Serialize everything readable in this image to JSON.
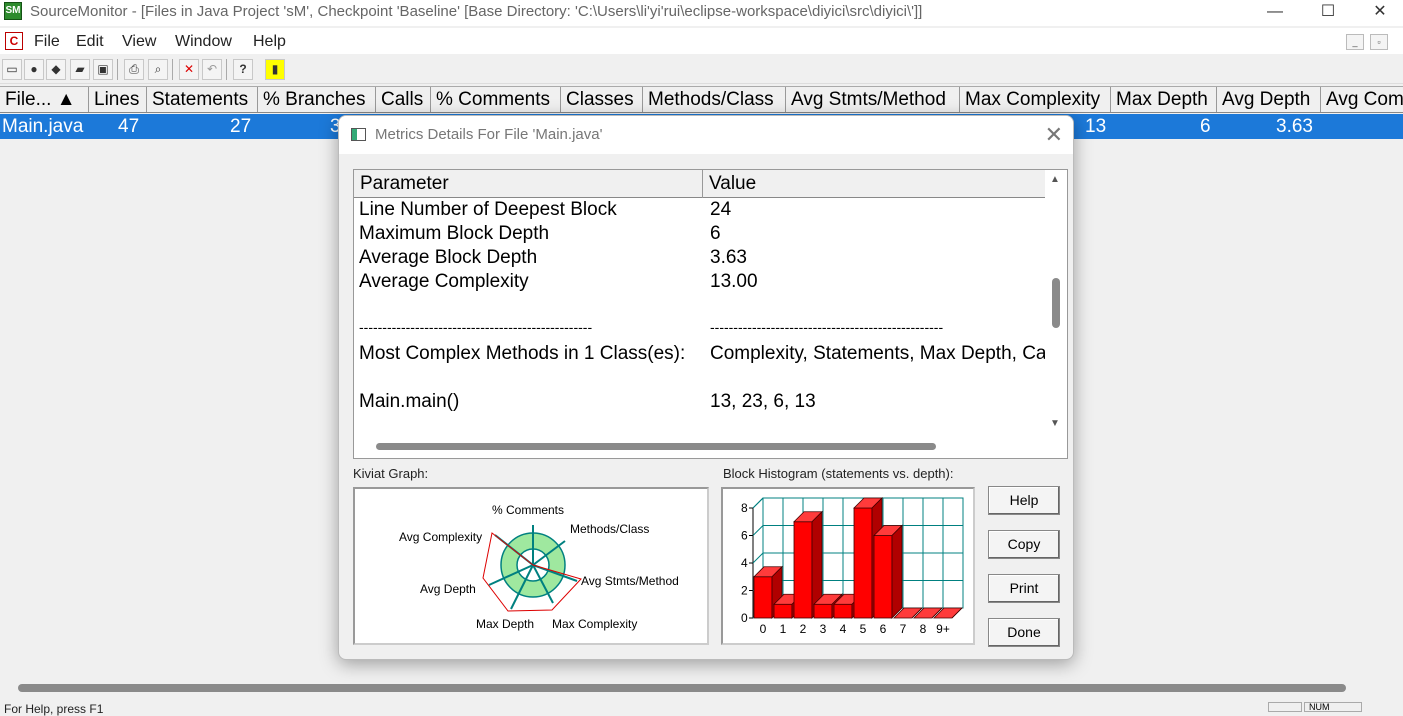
{
  "window": {
    "title": "SourceMonitor - [Files in Java Project 'sM', Checkpoint 'Baseline'  [Base Directory: 'C:\\Users\\li'yi'rui\\eclipse-workspace\\diyici\\src\\diyici\\']]",
    "minimize": "—",
    "maximize": "☐",
    "close": "✕"
  },
  "menu": {
    "items": [
      "File",
      "Edit",
      "View",
      "Window",
      "Help"
    ]
  },
  "table": {
    "headers": [
      "File... ▲",
      "Lines",
      "Statements",
      "% Branches",
      "Calls",
      "% Comments",
      "Classes",
      "Methods/Class",
      "Avg Stmts/Method",
      "Max Complexity",
      "Max Depth",
      "Avg Depth",
      "Avg Complexity"
    ],
    "row": {
      "file": "Main.java",
      "lines": "47",
      "statements": "27",
      "branches": "3",
      "max_complexity": "13",
      "max_depth": "6",
      "avg_depth": "3.63"
    }
  },
  "status": {
    "left": "For Help, press F1",
    "num": "NUM"
  },
  "dialog": {
    "title": "Metrics Details For File 'Main.java'",
    "close": "✕",
    "list_headers": {
      "param": "Parameter",
      "value": "Value"
    },
    "rows": [
      {
        "param": "Line Number of Deepest Block",
        "value": "24"
      },
      {
        "param": "Maximum Block Depth",
        "value": "6"
      },
      {
        "param": "Average Block Depth",
        "value": "3.63"
      },
      {
        "param": "Average Complexity",
        "value": "13.00"
      },
      {
        "param": "",
        "value": ""
      },
      {
        "param": "--------------------------------------------------",
        "value": "--------------------------------------------------"
      },
      {
        "param": "Most Complex Methods in 1 Class(es):",
        "value": "Complexity, Statements, Max Depth, Calls"
      },
      {
        "param": "",
        "value": ""
      },
      {
        "param": "Main.main()",
        "value": "13, 23, 6, 13"
      }
    ],
    "kiviat_label": "Kiviat Graph:",
    "histogram_label": "Block Histogram (statements vs. depth):",
    "kiviat_axes": [
      "% Comments",
      "Methods/Class",
      "Avg Stmts/Method",
      "Max Complexity",
      "Max Depth",
      "Avg Depth",
      "Avg Complexity"
    ],
    "buttons": {
      "help": "Help",
      "copy": "Copy",
      "print": "Print",
      "done": "Done"
    }
  },
  "chart_data": {
    "type": "bar",
    "title": "Block Histogram (statements vs. depth):",
    "categories": [
      "0",
      "1",
      "2",
      "3",
      "4",
      "5",
      "6",
      "7",
      "8",
      "9+"
    ],
    "values": [
      3,
      1,
      7,
      1,
      1,
      8,
      6,
      0,
      0,
      0
    ],
    "ylim": [
      0,
      8
    ],
    "yticks": [
      "0",
      "2",
      "4",
      "6",
      "8"
    ],
    "bar_color": "#ff0000",
    "grid": true
  }
}
